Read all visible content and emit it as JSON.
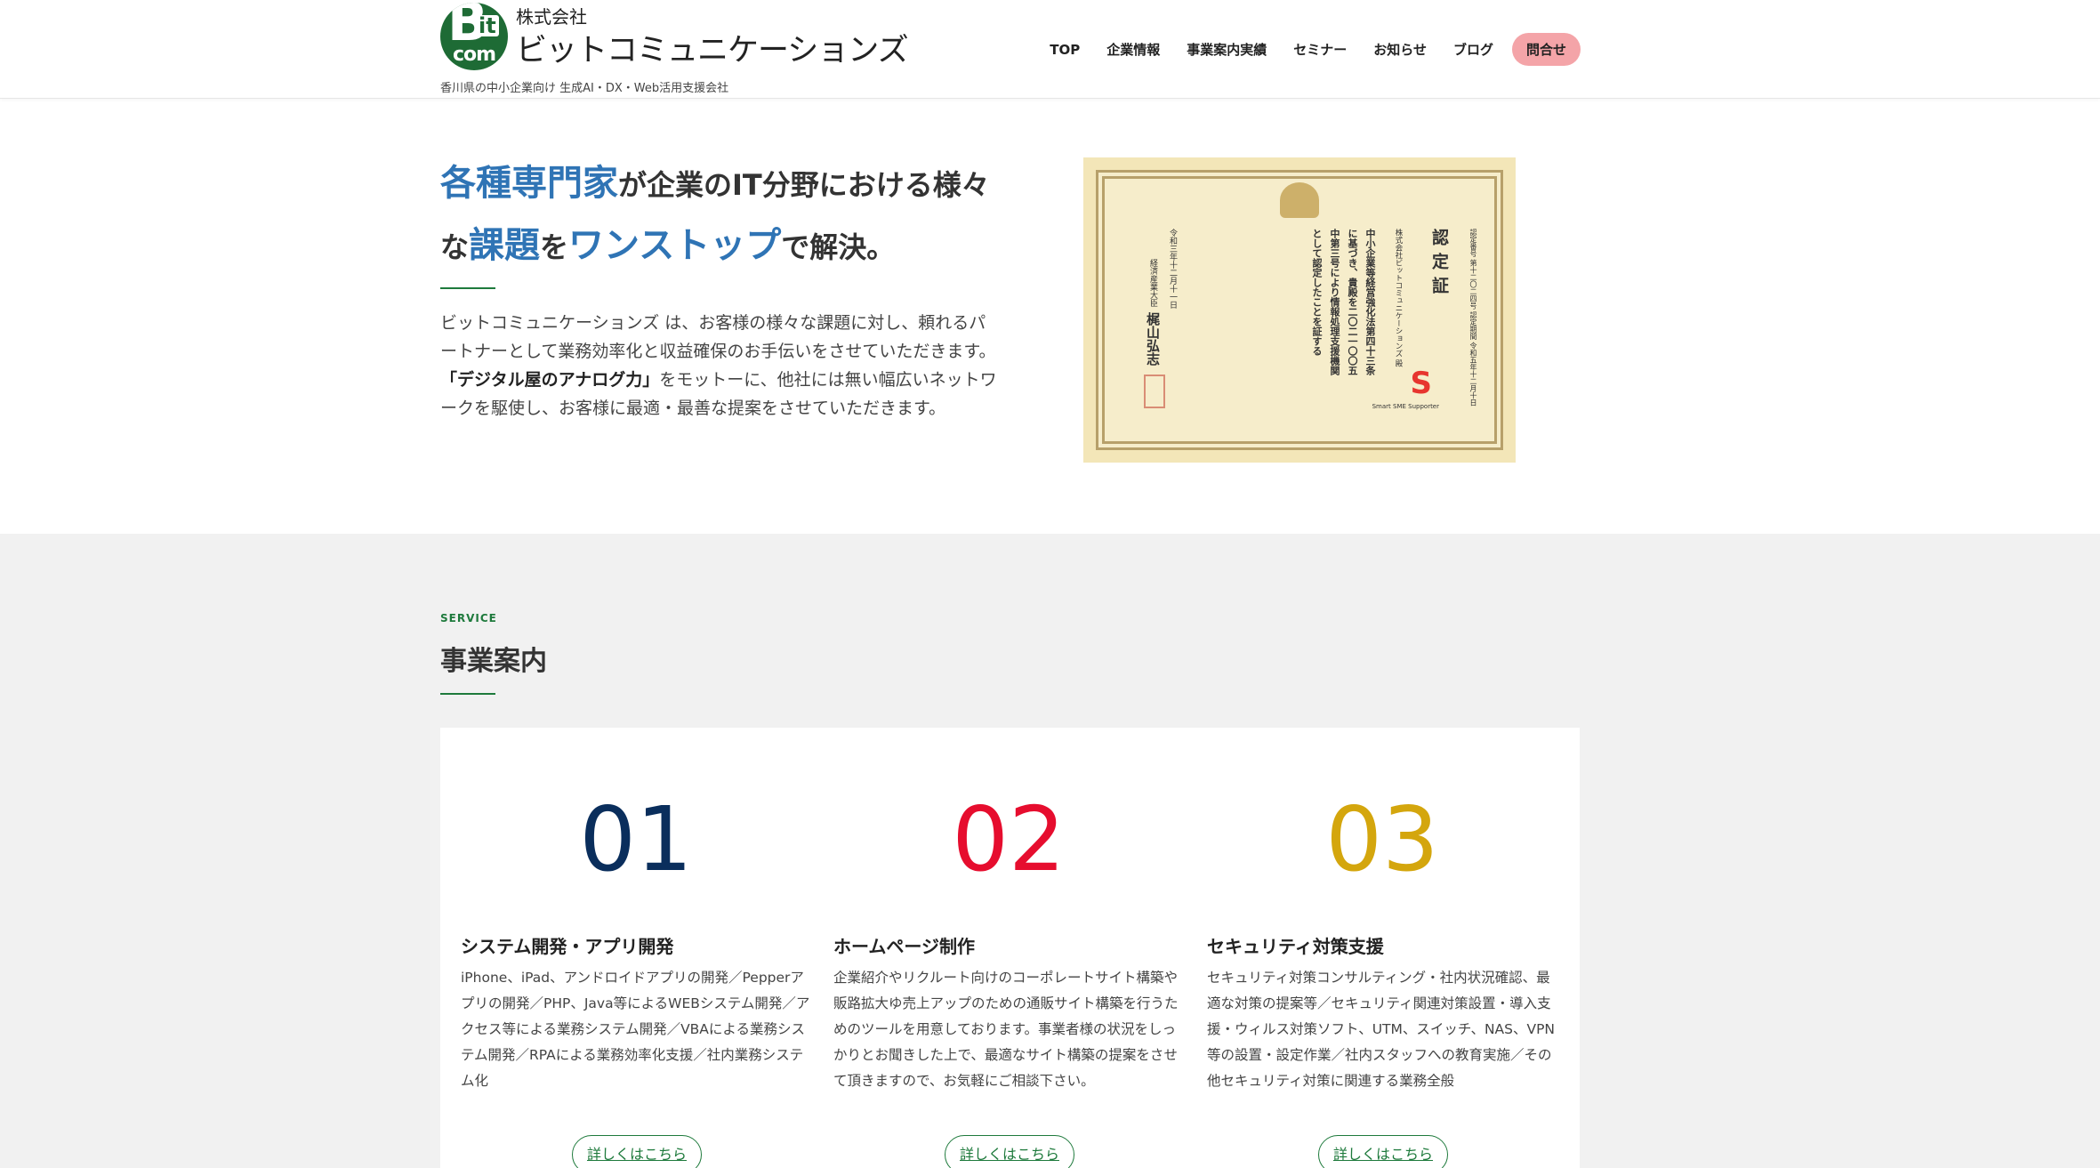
{
  "header": {
    "company_prefix": "株式会社",
    "company_name": "ビットコミュニケーションズ",
    "tagline": "香川県の中小企業向け 生成AI・DX・Web活用支援会社",
    "logo_letters": {
      "b": "B",
      "it": "it",
      "com": "com"
    },
    "nav": [
      "TOP",
      "企業情報",
      "事業案内実績",
      "セミナー",
      "お知らせ",
      "ブログ"
    ],
    "contact_label": "問合せ"
  },
  "hero": {
    "title_parts": {
      "p1": "各種専門家",
      "p2": "が企業のIT分野における様々な",
      "p3": "課題",
      "p4": "を",
      "p5": "ワンストップ",
      "p6": "で解決。"
    },
    "desc1": "ビットコミュニケーションズ は、お客様の様々な課題に対し、頼れるパートナーとして業務効率化と収益確保のお手伝いをさせていただきます。",
    "desc2_strong": "「デジタル屋のアナログ力」",
    "desc2_rest": "をモットーに、他社には無い幅広いネットワークを駆使し、お客様に最適・最善な提案をさせていただきます。"
  },
  "certificate": {
    "title": "認定証",
    "number": "認定番号 第十二〇二四号 認定期間 令和五年十二月十日",
    "company": "株式会社ビットコミュニケーションズ 殿",
    "line1": "中小企業等経営強化法第四十三条",
    "line2": "に基づき、貴殿を二〇二一〇〇五",
    "line3": "中第三号により情報処理支援機関",
    "line4": "として認定したことを証する",
    "date": "令和三年十二月十一日",
    "issuer": "経済産業大臣",
    "signer": "梶山弘志",
    "badge_letter": "S",
    "badge_text": "Smart SME Supporter"
  },
  "service": {
    "label": "SERVICE",
    "title": "事業案内",
    "items": [
      {
        "num": "01",
        "color": "#0a2e5c",
        "title": "システム開発・アプリ開発",
        "text": "iPhone、iPad、アンドロイドアプリの開発／Pepperアプリの開発／PHP、Java等によるWEBシステム開発／アクセス等による業務システム開発／VBAによる業務システム開発／RPAによる業務効率化支援／社内業務システム化",
        "more": "詳しくはこちら"
      },
      {
        "num": "02",
        "color": "#e60d2e",
        "title": "ホームページ制作",
        "text": "企業紹介やリクルート向けのコーポレートサイト構築や販路拡大ゆ売上アップのための通販サイト構築を行うためのツールを用意しております。事業者様の状況をしっかりとお聞きした上で、最適なサイト構築の提案をさせて頂きますので、お気軽にご相談下さい。",
        "more": "詳しくはこちら"
      },
      {
        "num": "03",
        "color": "#d4a60d",
        "title": "セキュリティ対策支援",
        "text": "セキュリティ対策コンサルティング・社内状況確認、最適な対策の提案等／セキュリティ関連対策設置・導入支援・ウィルス対策ソフト、UTM、スイッチ、NAS、VPN等の設置・設定作業／社内スタッフへの教育実施／その他セキュリティ対策に関連する業務全般",
        "more": "詳しくはこちら"
      }
    ]
  }
}
